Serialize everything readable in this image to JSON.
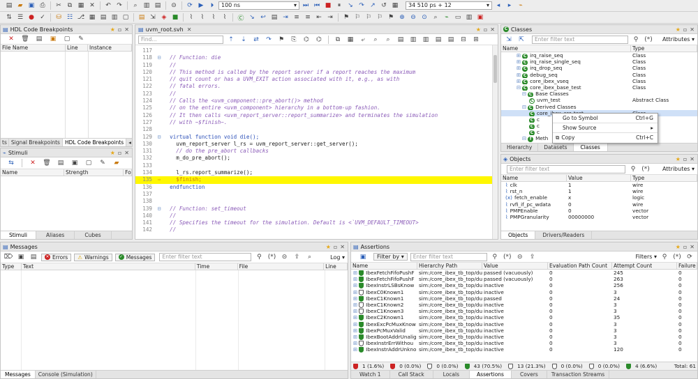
{
  "toolbar1": {
    "time_value": "100 ns",
    "time_now": "34 510 ps + 12"
  },
  "hdl": {
    "title": "HDL Code Breakpoints",
    "cols": [
      "File Name",
      "Line",
      "Instance"
    ],
    "tabs": [
      "ts",
      "Signal Breakpoints",
      "HDL Code Breakpoints"
    ]
  },
  "stimuli": {
    "title": "Stimuli",
    "cols": [
      "Name",
      "Strength",
      "Fo"
    ],
    "tabs": [
      "Stimuli",
      "Aliases",
      "Cubes"
    ]
  },
  "editor": {
    "tab": "uvm_root.svh",
    "find_placeholder": "Find...",
    "lines": [
      {
        "n": "117",
        "t": "",
        "c": "plain"
      },
      {
        "n": "118",
        "t": "  // Function: die",
        "c": "cmt"
      },
      {
        "n": "119",
        "t": "  //",
        "c": "cmt"
      },
      {
        "n": "120",
        "t": "  // This method is called by the report server if a report reaches the maximum",
        "c": "cmt"
      },
      {
        "n": "121",
        "t": "  // quit count or has a UVM_EXIT action associated with it, e.g., as with",
        "c": "cmt"
      },
      {
        "n": "122",
        "t": "  // fatal errors.",
        "c": "cmt"
      },
      {
        "n": "123",
        "t": "  //",
        "c": "cmt"
      },
      {
        "n": "124",
        "t": "  // Calls the <uvm_component::pre_abort()> method",
        "c": "cmt"
      },
      {
        "n": "125",
        "t": "  // on the entire <uvm_component> hierarchy in a bottom-up fashion.",
        "c": "cmt"
      },
      {
        "n": "126",
        "t": "  // It then calls <uvm_report_server::report_summarize> and terminates the simulation",
        "c": "cmt"
      },
      {
        "n": "127",
        "t": "  // with ~$finish~.",
        "c": "cmt"
      },
      {
        "n": "128",
        "t": "",
        "c": "plain"
      },
      {
        "n": "129",
        "t": "  virtual function void die();",
        "c": "kw"
      },
      {
        "n": "130",
        "t": "    uvm_report_server l_rs = uvm_report_server::get_server();",
        "c": "plain"
      },
      {
        "n": "131",
        "t": "    // do the pre_abort callbacks",
        "c": "cmt"
      },
      {
        "n": "132",
        "t": "    m_do_pre_abort();",
        "c": "plain"
      },
      {
        "n": "133",
        "t": "",
        "c": "plain"
      },
      {
        "n": "134",
        "t": "    l_rs.report_summarize();",
        "c": "plain"
      },
      {
        "n": "135",
        "t": "    $finish;",
        "c": "hl"
      },
      {
        "n": "136",
        "t": "  endfunction",
        "c": "kw"
      },
      {
        "n": "137",
        "t": "",
        "c": "plain"
      },
      {
        "n": "138",
        "t": "",
        "c": "plain"
      },
      {
        "n": "139",
        "t": "  // Function: set_timeout",
        "c": "cmt"
      },
      {
        "n": "140",
        "t": "  //",
        "c": "cmt"
      },
      {
        "n": "141",
        "t": "  // Specifies the timeout for the simulation. Default is <`UVM_DEFAULT_TIMEOUT>",
        "c": "cmt"
      },
      {
        "n": "142",
        "t": "  //",
        "c": "cmt"
      }
    ]
  },
  "classes": {
    "title": "Classes",
    "filter_placeholder": "Enter filter text",
    "attributes_label": "Attributes",
    "cols": [
      "Name",
      "Type"
    ],
    "rows": [
      {
        "name": "irq_raise_seq",
        "type": "Class",
        "indent": 1
      },
      {
        "name": "irq_raise_single_seq",
        "type": "Class",
        "indent": 1
      },
      {
        "name": "irq_drop_seq",
        "type": "Class",
        "indent": 1
      },
      {
        "name": "debug_seq",
        "type": "Class",
        "indent": 1
      },
      {
        "name": "core_ibex_vseq",
        "type": "Class",
        "indent": 1
      },
      {
        "name": "core_ibex_base_test",
        "type": "Class",
        "indent": 1
      },
      {
        "name": "Base Classes",
        "type": "",
        "indent": 2
      },
      {
        "name": "uvm_test",
        "type": "Abstract Class",
        "indent": 3
      },
      {
        "name": "Derived Classes",
        "type": "",
        "indent": 2
      },
      {
        "name": "core_ibex_csr_test",
        "type": "Class",
        "indent": 3
      },
      {
        "name": "c",
        "type": "",
        "indent": 3
      },
      {
        "name": "c",
        "type": "",
        "indent": 3
      },
      {
        "name": "c",
        "type": "",
        "indent": 3
      },
      {
        "name": "Meth",
        "type": "",
        "indent": 2
      }
    ],
    "tabs": [
      "Hierarchy",
      "Datasets",
      "Classes"
    ],
    "menu": [
      {
        "label": "Go to Symbol",
        "shortcut": "Ctrl+G"
      },
      {
        "label": "Show Source",
        "shortcut": "▸"
      },
      {
        "label": "Copy",
        "shortcut": "Ctrl+C"
      }
    ]
  },
  "objects": {
    "title": "Objects",
    "filter_placeholder": "Enter filter text",
    "attributes_label": "Attributes",
    "cols": [
      "Name",
      "Value",
      "Type"
    ],
    "rows": [
      {
        "name": "clk",
        "value": "1",
        "type": "wire"
      },
      {
        "name": "rst_n",
        "value": "1",
        "type": "wire"
      },
      {
        "name": "fetch_enable",
        "value": "x",
        "type": "logic"
      },
      {
        "name": "rvfi_if_pc_wdata",
        "value": "0",
        "type": "wire"
      },
      {
        "name": "PMPEnable",
        "value": "0",
        "type": "vector"
      },
      {
        "name": "PMPGranularity",
        "value": "00000000",
        "type": "vector"
      }
    ],
    "tabs": [
      "Objects",
      "Drivers/Readers"
    ]
  },
  "messages": {
    "title": "Messages",
    "btn_errors": "Errors",
    "btn_warnings": "Warnings",
    "btn_messages": "Messages",
    "filter_placeholder": "Enter filter text",
    "log_label": "Log",
    "cols": [
      "Type",
      "Text",
      "Time",
      "File",
      "Line"
    ],
    "tabs": [
      "Messages",
      "Console (Simulation)"
    ]
  },
  "assertions": {
    "title": "Assertions",
    "filter_by": "Filter by",
    "filter_placeholder": "Enter filter text",
    "filters_label": "Filters",
    "cols": [
      "Name",
      "Hierarchy Path",
      "Value",
      "Evaluation Path Count",
      "Attempt Count",
      "Failure"
    ],
    "rows": [
      {
        "name": "IbexFetchFifoPushF",
        "path": "sim:/core_ibex_tb_top/dut/",
        "value": "passed (vacuously)",
        "eval": "0",
        "att": "245",
        "fail": "0",
        "s": "g"
      },
      {
        "name": "IbexFetchFifoPushF",
        "path": "sim:/core_ibex_tb_top/dut/",
        "value": "passed (vacuously)",
        "eval": "0",
        "att": "263",
        "fail": "0",
        "s": "g"
      },
      {
        "name": "IbexInstrLSBsKnow",
        "path": "sim:/core_ibex_tb_top/dut/",
        "value": "inactive",
        "eval": "0",
        "att": "256",
        "fail": "0",
        "s": "g"
      },
      {
        "name": "IbexC0Known1",
        "path": "sim:/core_ibex_tb_top/dut/",
        "value": "inactive",
        "eval": "0",
        "att": "3",
        "fail": "0",
        "s": "w"
      },
      {
        "name": "IbexC1Known1",
        "path": "sim:/core_ibex_tb_top/dut/",
        "value": "passed",
        "eval": "0",
        "att": "24",
        "fail": "0",
        "s": "g"
      },
      {
        "name": "IbexC1Known2",
        "path": "sim:/core_ibex_tb_top/dut/",
        "value": "inactive",
        "eval": "0",
        "att": "3",
        "fail": "0",
        "s": "w"
      },
      {
        "name": "IbexC1Known3",
        "path": "sim:/core_ibex_tb_top/dut/",
        "value": "inactive",
        "eval": "0",
        "att": "3",
        "fail": "0",
        "s": "w"
      },
      {
        "name": "IbexC2Known1",
        "path": "sim:/core_ibex_tb_top/dut/",
        "value": "inactive",
        "eval": "0",
        "att": "35",
        "fail": "0",
        "s": "g"
      },
      {
        "name": "IbexExcPcMuxKnow",
        "path": "sim:/core_ibex_tb_top/dut/",
        "value": "inactive",
        "eval": "0",
        "att": "3",
        "fail": "0",
        "s": "g"
      },
      {
        "name": "IbexPcMuxValid",
        "path": "sim:/core_ibex_tb_top/dut/",
        "value": "inactive",
        "eval": "0",
        "att": "3",
        "fail": "0",
        "s": "g"
      },
      {
        "name": "IbexBootAddrUnalig",
        "path": "sim:/core_ibex_tb_top/dut/",
        "value": "inactive",
        "eval": "0",
        "att": "3",
        "fail": "0",
        "s": "g"
      },
      {
        "name": "IbexInstrErrWithou",
        "path": "sim:/core_ibex_tb_top/dut/",
        "value": "inactive",
        "eval": "0",
        "att": "3",
        "fail": "0",
        "s": "w"
      },
      {
        "name": "IbexInstrAddrUnkno",
        "path": "sim:/core_ibex_tb_top/dut/",
        "value": "inactive",
        "eval": "0",
        "att": "120",
        "fail": "0",
        "s": "g"
      }
    ],
    "stats": [
      "1 (1.6%)",
      "0 (0.0%)",
      "0 (0.0%)",
      "43 (70.5%)",
      "13 (21.3%)",
      "0 (0.0%)",
      "0 (0.0%)",
      "4 (6.6%)"
    ],
    "total": "Total: 61",
    "tabs": [
      "Watch 1",
      "Call Stack",
      "Locals",
      "Assertions",
      "Covers",
      "Transaction Streams"
    ]
  }
}
